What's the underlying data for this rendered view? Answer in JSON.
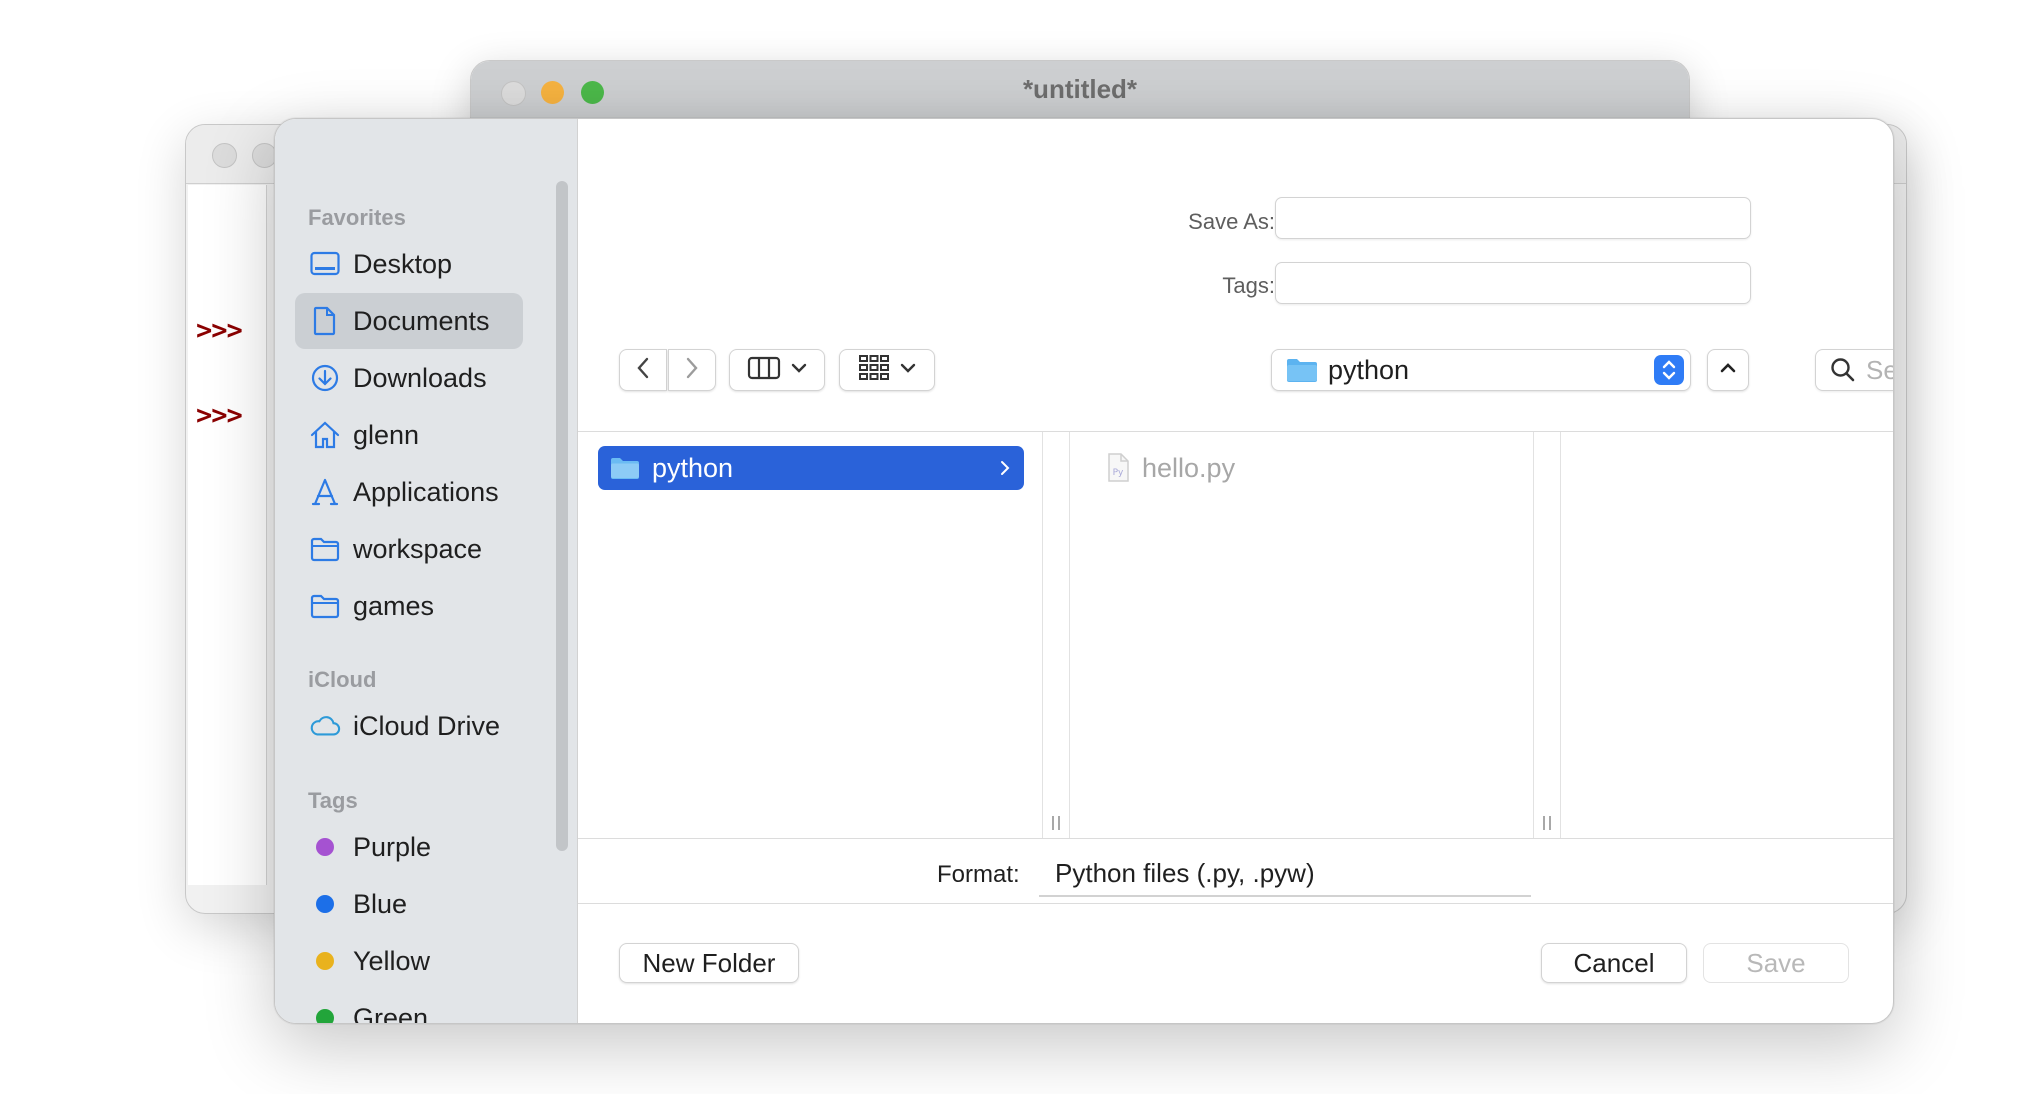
{
  "back_window": {
    "title": "*untitled*",
    "colors": {
      "red": "#dcdcdc",
      "yellow": "#f5b240",
      "green": "#4cb84a"
    }
  },
  "shell": {
    "prompt_1": ">>>",
    "prompt_2": ">>>"
  },
  "sidebar": {
    "favorites_heading": "Favorites",
    "favorites": [
      {
        "label": "Desktop",
        "icon": "desktop-icon"
      },
      {
        "label": "Documents",
        "icon": "document-icon",
        "selected": true
      },
      {
        "label": "Downloads",
        "icon": "download-icon"
      },
      {
        "label": "glenn",
        "icon": "home-icon"
      },
      {
        "label": "Applications",
        "icon": "applications-icon"
      },
      {
        "label": "workspace",
        "icon": "folder-icon"
      },
      {
        "label": "games",
        "icon": "folder-icon"
      }
    ],
    "icloud_heading": "iCloud",
    "icloud": [
      {
        "label": "iCloud Drive",
        "icon": "cloud-icon"
      }
    ],
    "tags_heading": "Tags",
    "tags": [
      {
        "label": "Purple",
        "color": "#a552d1"
      },
      {
        "label": "Blue",
        "color": "#1c6fe8"
      },
      {
        "label": "Yellow",
        "color": "#e9b21d"
      },
      {
        "label": "Green",
        "color": "#22a53a"
      }
    ]
  },
  "form": {
    "save_as_label": "Save As:",
    "save_as_value": "",
    "tags_label": "Tags:",
    "tags_value": ""
  },
  "toolbar": {
    "location": "python",
    "search_placeholder": "Search",
    "accent": "#2f7cf6"
  },
  "browser": {
    "column1": [
      {
        "label": "python",
        "selected": true
      }
    ],
    "column2": [
      {
        "label": "hello.py",
        "disabled": true
      }
    ]
  },
  "format": {
    "label": "Format:",
    "value": "Python files (.py, .pyw)"
  },
  "buttons": {
    "new_folder": "New Folder",
    "cancel": "Cancel",
    "save": "Save"
  }
}
